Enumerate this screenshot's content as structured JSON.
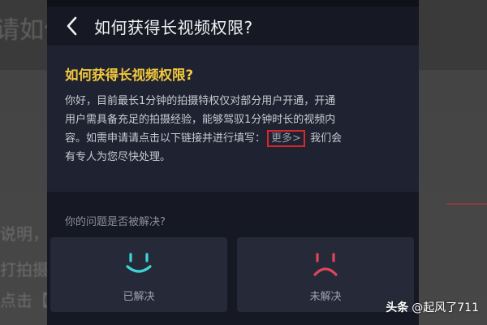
{
  "background": {
    "title_fragment": "请如何",
    "line_1": "说明，",
    "line_2": "打拍摄",
    "line_3": "点击【"
  },
  "header": {
    "back_icon": "chevron-left-icon",
    "title": "如何获得长视频权限?"
  },
  "answer": {
    "title": "如何获得长视频权限?",
    "line_1": "你好，目前最长1分钟的拍摄特权仅对部分用户开通，开通",
    "line_2": "用户需具备充足的拍摄经验，能够驾驭1分钟时长的视频内",
    "line_3_pre": "容。如需申请请点击以下链接并进行填写：",
    "more_link": "更多>",
    "line_3_post": "我们会",
    "line_4": "有专人为您尽快处理。"
  },
  "feedback": {
    "question": "你的问题是否被解决?",
    "resolved_label": "已解决",
    "resolved_icon": "smile-face-icon",
    "unresolved_label": "未解决",
    "unresolved_icon": "sad-face-icon"
  },
  "watermark": {
    "brand": "头条",
    "handle": "@起风了711"
  },
  "colors": {
    "accent_yellow": "#f3c93d",
    "highlight_red": "#d9282d",
    "smile_cyan": "#3fd4d8",
    "sad_red": "#e0455a",
    "panel_dark": "#161824"
  }
}
